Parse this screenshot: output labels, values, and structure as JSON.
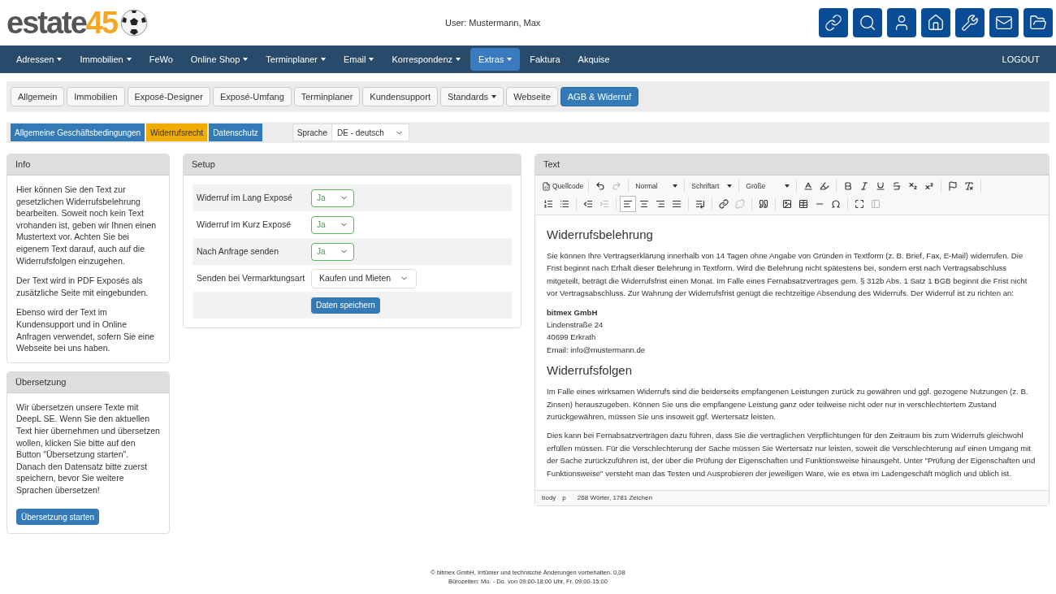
{
  "header": {
    "logo": {
      "text_1": "estate",
      "text_2": "45"
    },
    "user": "User: Mustermann, Max"
  },
  "nav": {
    "items": [
      {
        "label": "Adressen",
        "dropdown": true,
        "selected": false
      },
      {
        "label": "Immobilien",
        "dropdown": true,
        "selected": false
      },
      {
        "label": "FeWo",
        "dropdown": false,
        "selected": false
      },
      {
        "label": "Online Shop",
        "dropdown": true,
        "selected": false
      },
      {
        "label": "Terminplaner",
        "dropdown": true,
        "selected": false
      },
      {
        "label": "Email",
        "dropdown": true,
        "selected": false
      },
      {
        "label": "Korrespondenz",
        "dropdown": true,
        "selected": false
      },
      {
        "label": "Extras",
        "dropdown": true,
        "selected": true
      },
      {
        "label": "Faktura",
        "dropdown": false,
        "selected": false
      },
      {
        "label": "Akquise",
        "dropdown": false,
        "selected": false
      }
    ],
    "logout": "LOGOUT"
  },
  "tabs": [
    {
      "label": "Allgemein",
      "dropdown": false,
      "selected": false
    },
    {
      "label": "Immobilien",
      "dropdown": false,
      "selected": false
    },
    {
      "label": "Exposé-Designer",
      "dropdown": false,
      "selected": false
    },
    {
      "label": "Exposé-Umfang",
      "dropdown": false,
      "selected": false
    },
    {
      "label": "Terminplaner",
      "dropdown": false,
      "selected": false
    },
    {
      "label": "Kundensupport",
      "dropdown": false,
      "selected": false
    },
    {
      "label": "Standards",
      "dropdown": true,
      "selected": false
    },
    {
      "label": "Webseite",
      "dropdown": false,
      "selected": false
    },
    {
      "label": "AGB & Widerruf",
      "dropdown": false,
      "selected": true
    }
  ],
  "subtabs": [
    {
      "label": "Allgemeine Geschäftsbedingungen",
      "selected": false
    },
    {
      "label": "Widerrufsrecht",
      "selected": true
    },
    {
      "label": "Datenschutz",
      "selected": false
    }
  ],
  "language": {
    "label": "Sprache",
    "value": "DE - deutsch"
  },
  "info": {
    "title": "Info",
    "paragraphs": [
      "Hier können Sie den Text zur gesetzlichen Widerrufsbelehrung bearbeiten. Soweit noch kein Text vrohanden ist, geben wir Ihnen einen Mustertext vor. Achten Sie bei eigenem Text darauf, auch auf die Widerrufsfolgen einzugehen.",
      "Der Text wird in PDF Exposés als zusätzliche Seite mit eingebunden.",
      "Ebenso wird der Text im Kundensupport und in Online Anfragen verwendet, sofern Sie eine Webseite bei uns haben."
    ]
  },
  "translation": {
    "title": "Übersetzung",
    "paragraphs": [
      "Wir übersetzen unsere Texte mit DeepL SE. Wenn Sie den aktuellen Text hier übernehmen und übersetzen wollen, klicken Sie bitte auf den Button \"Übersetzung starten\". Danach den Datensatz bitte zuerst speichern, bevor Sie weitere Sprachen übersetzen!"
    ],
    "button": "Übersetzung starten"
  },
  "setup": {
    "title": "Setup",
    "rows": [
      {
        "label": "Widerruf im Lang Exposé",
        "value": "Ja",
        "kind": "yesno"
      },
      {
        "label": "Widerruf im Kurz Exposé",
        "value": "Ja",
        "kind": "yesno"
      },
      {
        "label": "Nach Anfrage senden",
        "value": "Ja",
        "kind": "yesno"
      },
      {
        "label": "Senden bei Vermarktungsart",
        "value": "Kaufen und Mieten",
        "kind": "select"
      }
    ],
    "save": "Daten speichern"
  },
  "editor": {
    "title": "Text",
    "toolbar": {
      "source": "Quellcode",
      "format": "Normal",
      "font": "Schriftart",
      "size": "Größe"
    },
    "content": [
      {
        "kind": "heading",
        "text": "Widerrufsbelehrung"
      },
      {
        "kind": "paragraph",
        "text": "Sie können Ihre Vertragserklärung innerhalb von 14 Tagen ohne Angabe von Gründen in Textform (z. B. Brief, Fax, E-Mail) widerrufen. Die Frist beginnt nach Erhalt dieser Belehrung in Textform. Wird die Belehrung nicht spätestens bei, sondern erst nach Vertragsabschluss mitgeteilt, beträgt die Widerrufsfrist einen Monat. Im Falle eines Fernabsatzvertrages gem. § 312b Abs. 1 Satz 1 BGB beginnt die Frist nicht vor Vertragsabschluss. Zur Wahrung der Widerrufsfrist genügt die rechtzeitige Absendung des Widerrufs. Der Widerruf ist zu richten an:"
      },
      {
        "kind": "address",
        "lines": [
          "bitmex GmbH",
          "Lindenstraße 24",
          "40699 Erkrath",
          "Email: info@mustermann.de"
        ]
      },
      {
        "kind": "heading",
        "text": "Widerrufsfolgen"
      },
      {
        "kind": "paragraph",
        "text": "Im Falle eines wirksamen Widerrufs sind die beiderseits empfangenen Leistungen zurück zu gewähren und ggf. gezogene Nutzungen (z. B. Zinsen) herauszugeben. Können Sie uns die empfangene Leistung ganz oder teilweise nicht oder nur in verschlechtertem Zustand zurückgewähren, müssen Sie uns insoweit ggf. Wertersatz leisten."
      },
      {
        "kind": "paragraph",
        "text": "Dies kann bei Fernabsatzverträgen dazu führen, dass Sie die vertraglichen Verpflichtungen für den Zeitraum bis zum Widerrufs gleichwohl erfüllen müssen. Für die Verschlechterung der Sache müssen Sie Wertersatz nur leisten, soweit die Verschlechterung auf einen Umgang mit der Sache zurückzuführen ist, der über die Prüfung der Eigenschaften und Funktionsweise hinausgeht. Unter \"Prüfung der Eigenschaften und Funktionsweise\" versteht man das Testen und Ausprobieren der jeweiligen Ware, wie es etwa im Ladengeschäft möglich und üblich ist."
      }
    ],
    "status": {
      "path": [
        "body",
        "p"
      ],
      "count": "268 Wörter, 1781 Zeichen"
    }
  },
  "footer": [
    "© bitmex GmbH, Irrtümer und technische Änderungen vorbehalten. 0,08",
    "Bürozeiten: Mo. - Do. von 09:00-18:00 Uhr, Fr. 09:00-15:00"
  ]
}
